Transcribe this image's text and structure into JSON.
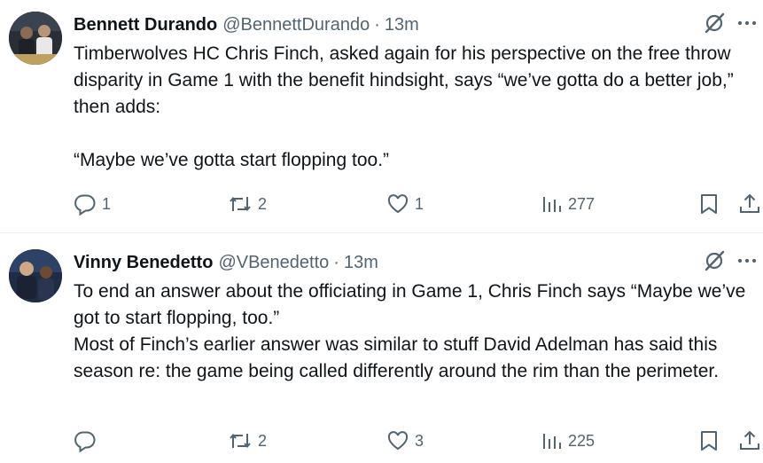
{
  "tweets": [
    {
      "name": "Bennett Durando",
      "handle": "@BennettDurando",
      "separator": "·",
      "time": "13m",
      "paragraphs": [
        "Timberwolves HC Chris Finch, asked again for his perspective on the free throw disparity in Game 1 with the benefit hindsight, says “we’ve gotta do a better job,” then adds:",
        "“Maybe we’ve gotta start flopping too.”"
      ],
      "replies": "1",
      "reposts": "2",
      "likes": "1",
      "views": "277"
    },
    {
      "name": "Vinny Benedetto",
      "handle": "@VBenedetto",
      "separator": "·",
      "time": "13m",
      "paragraphs": [
        "To end an answer about the officiating in Game 1, Chris Finch says “Maybe we’ve got to start flopping, too.”",
        "Most of Finch’s earlier answer was similar to stuff David Adelman has said this season re: the game being called differently around the rim than the perimeter."
      ],
      "replies": "",
      "reposts": "2",
      "likes": "3",
      "views": "225"
    }
  ],
  "icons": {
    "grok": "grok-icon",
    "more": "more-icon",
    "reply": "reply-icon",
    "repost": "repost-icon",
    "like": "like-icon",
    "views": "views-icon",
    "bookmark": "bookmark-icon",
    "share": "share-icon"
  },
  "colors": {
    "text": "#0f1419",
    "secondary": "#536471",
    "divider": "#eff3f4"
  }
}
